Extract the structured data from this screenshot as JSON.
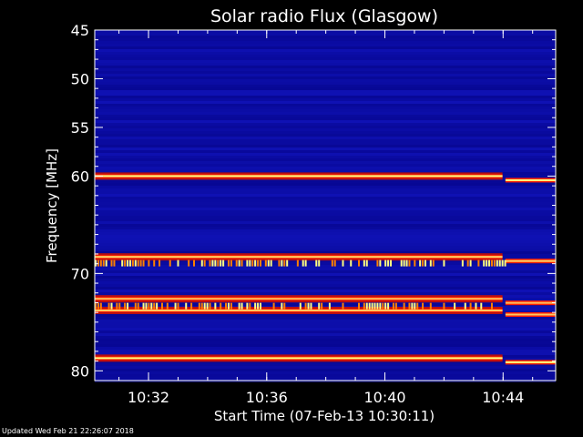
{
  "chart_data": {
    "type": "heatmap",
    "title": "Solar radio Flux (Glasgow)",
    "xlabel": "Start Time (07-Feb-13 10:30:11)",
    "ylabel": "Frequency [MHz]",
    "x_range_minutes": [
      0.0,
      15.6
    ],
    "x_ticks": [
      {
        "label": "10:32",
        "minutes": 1.82
      },
      {
        "label": "10:36",
        "minutes": 5.82
      },
      {
        "label": "10:40",
        "minutes": 9.82
      },
      {
        "label": "10:44",
        "minutes": 13.82
      }
    ],
    "y_range": [
      45,
      81
    ],
    "y_ticks": [
      45,
      50,
      55,
      60,
      70,
      80
    ],
    "grid": false,
    "colors": {
      "background": "#000000",
      "base": "#1010a8",
      "band": "#ff2000",
      "peak": "#ffff80"
    },
    "bands": [
      {
        "freq": 60.0,
        "intensity": 1.0
      },
      {
        "freq": 68.3,
        "intensity": 0.8
      },
      {
        "freq": 72.6,
        "intensity": 0.7
      },
      {
        "freq": 73.8,
        "intensity": 0.75
      },
      {
        "freq": 78.7,
        "intensity": 1.0
      }
    ],
    "bursts": [
      {
        "freq": 68.9,
        "from_minutes": 0.0,
        "to_minutes": 13.9
      },
      {
        "freq": 73.3,
        "from_minutes": 0.0,
        "to_minutes": 13.5
      }
    ]
  },
  "footer": {
    "updated": "Updated Wed Feb 21 22:26:07 2018"
  }
}
